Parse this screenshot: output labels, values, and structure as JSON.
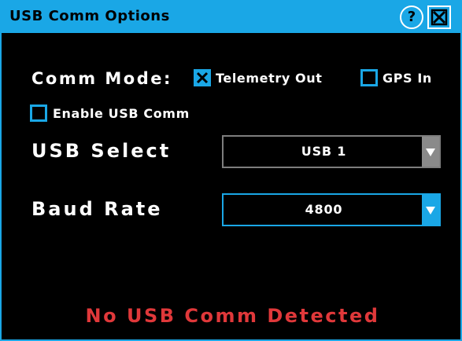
{
  "window": {
    "title": "USB Comm Options",
    "help_symbol": "?"
  },
  "comm_mode": {
    "label": "Comm Mode:",
    "options": [
      {
        "label": "Telemetry Out",
        "checked": true
      },
      {
        "label": "GPS In",
        "checked": false
      }
    ]
  },
  "enable_usb": {
    "label": "Enable USB Comm",
    "checked": false
  },
  "usb_select": {
    "label": "USB Select",
    "value": "USB 1",
    "enabled": false
  },
  "baud_rate": {
    "label": "Baud Rate",
    "value": "4800",
    "enabled": true
  },
  "status": {
    "message": "No USB Comm Detected",
    "color": "#e0383a"
  },
  "colors": {
    "accent": "#1aa7e6",
    "background": "#000000",
    "disabled": "#8a8a8a"
  }
}
